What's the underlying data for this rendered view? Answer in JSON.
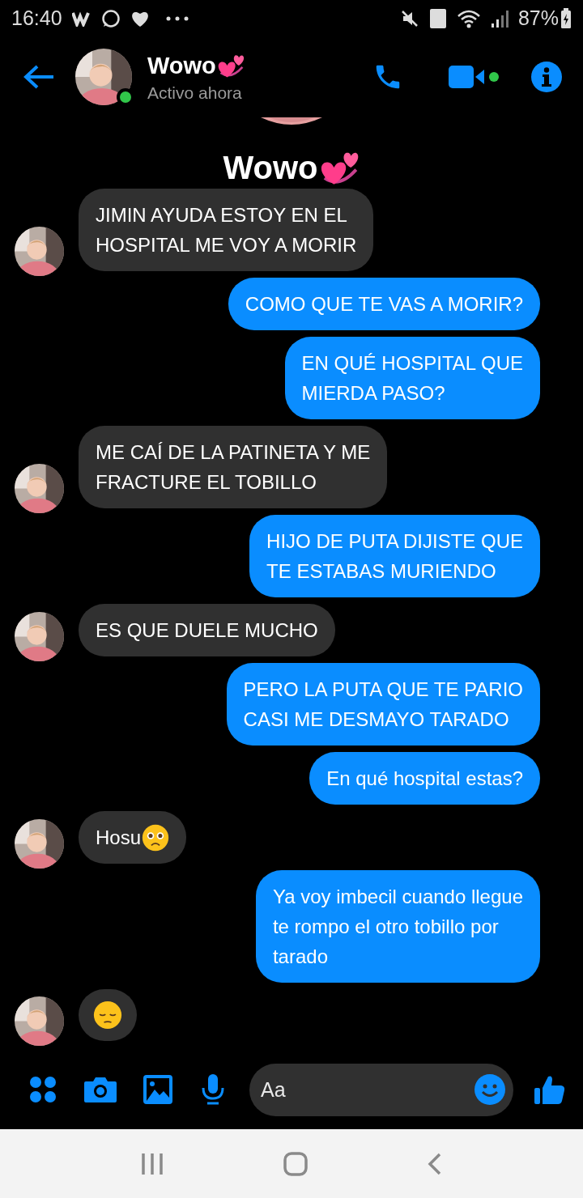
{
  "status_bar": {
    "time": "16:40",
    "battery": "87%"
  },
  "header": {
    "name": "Wowo",
    "status": "Activo ahora",
    "active": true
  },
  "conversation_title": "Wowo",
  "messages": [
    {
      "kind": "received",
      "avatar": true,
      "text": "JIMIN AYUDA ESTOY EN EL\nHOSPITAL ME VOY A MORIR"
    },
    {
      "kind": "sent",
      "text": "COMO QUE TE VAS A MORIR?"
    },
    {
      "kind": "sent",
      "text": "EN QUÉ HOSPITAL QUE\nMIERDA PASO?"
    },
    {
      "kind": "received",
      "avatar": true,
      "text": "ME CAÍ DE LA PATINETA Y ME\nFRACTURE EL TOBILLO"
    },
    {
      "kind": "sent",
      "text": "HIJO DE PUTA DIJISTE QUE\nTE ESTABAS MURIENDO"
    },
    {
      "kind": "received",
      "avatar": true,
      "text": "ES QUE DUELE MUCHO"
    },
    {
      "kind": "sent",
      "text": "PERO LA PUTA QUE TE PARIO\nCASI ME DESMAYO TARADO"
    },
    {
      "kind": "sent",
      "text": "En qué hospital estas?"
    },
    {
      "kind": "received",
      "avatar": true,
      "text": "Hosu",
      "emoji": {
        "kind": "pleading"
      }
    },
    {
      "kind": "sent",
      "text": "Ya voy imbecil cuando llegue\nte rompo el otro tobillo por\ntarado"
    },
    {
      "kind": "received",
      "avatar": true,
      "emoji": {
        "kind": "pensive"
      }
    }
  ],
  "composer": {
    "placeholder": "Aa"
  }
}
